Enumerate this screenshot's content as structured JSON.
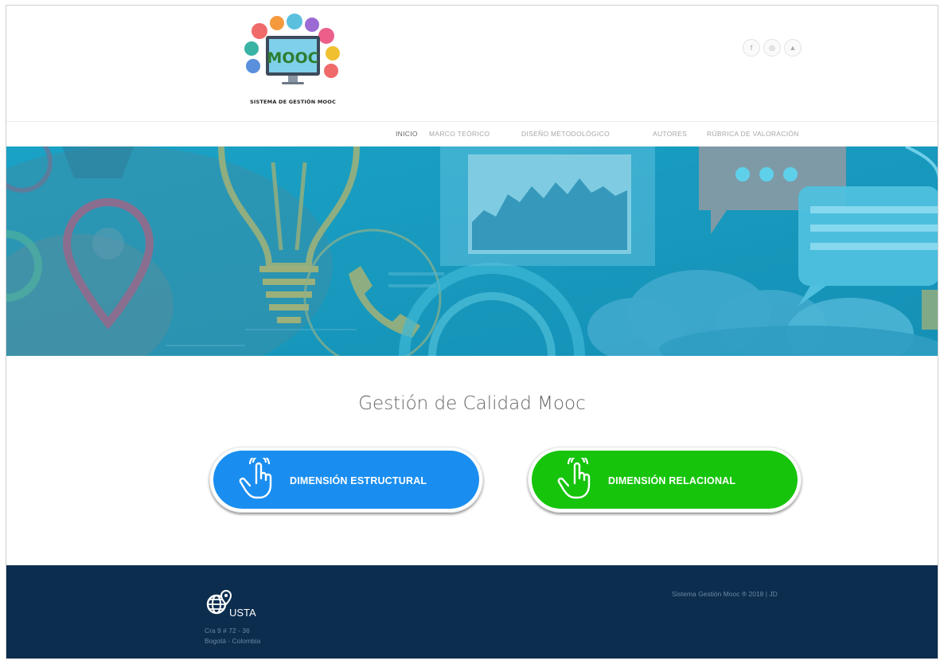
{
  "brand": {
    "logo_text": "MOOC",
    "tagline": "SISTEMA DE GESTIÓN MOOC"
  },
  "social": [
    {
      "icon": "facebook-icon",
      "glyph": "f"
    },
    {
      "icon": "instagram-icon",
      "glyph": "◎"
    },
    {
      "icon": "youtube-icon",
      "glyph": "▲"
    }
  ],
  "nav": {
    "items": [
      {
        "label": "INICIO",
        "active": true
      },
      {
        "label": "MARCO TEÓRICO",
        "active": false
      },
      {
        "label": "DISEÑO METODOLÓGICO",
        "active": false
      },
      {
        "label": "AUTORES",
        "active": false
      },
      {
        "label": "RÚBRICA DE VALORACIÓN",
        "active": false
      }
    ]
  },
  "main": {
    "title": "Gestión de Calidad Mooc",
    "buttons": [
      {
        "label": "DIMENSIÓN ESTRUCTURAL",
        "color": "#1a8ef0",
        "icon": "hand-pointer-icon"
      },
      {
        "label": "DIMENSIÓN RELACIONAL",
        "color": "#16c40c",
        "icon": "hand-pointer-icon"
      }
    ]
  },
  "footer": {
    "brand": "USTA",
    "address_line1": "Cra 9 # 72 - 36",
    "address_line2": "Bogotá - Colombia",
    "copyright": "Sistema Gestión Mooc ® 2018 | JD"
  },
  "colors": {
    "hero_bg": "#1a9fc2",
    "footer_bg": "#0c2d4e"
  }
}
